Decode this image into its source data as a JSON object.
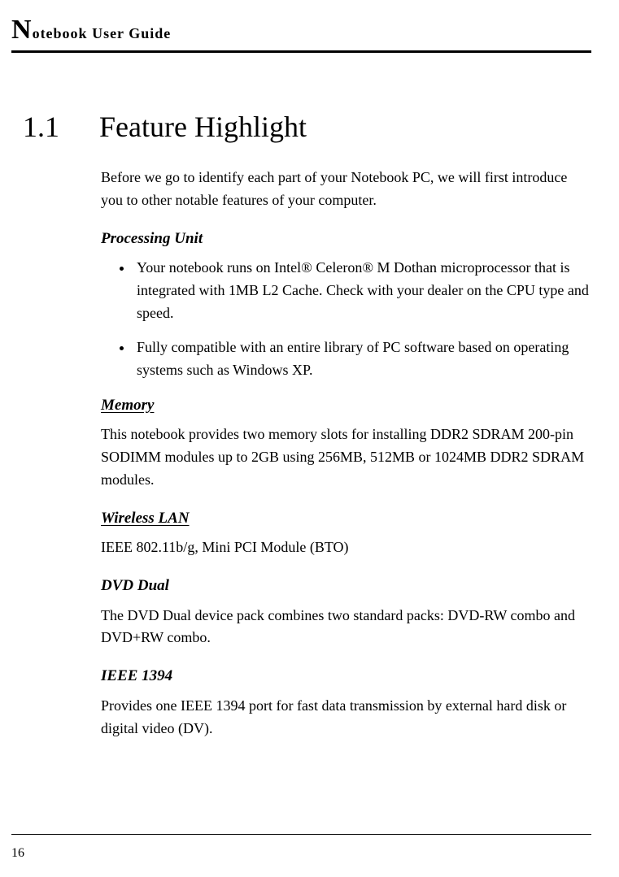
{
  "header": {
    "bigLetter": "N",
    "rest": "otebook User Guide"
  },
  "section": {
    "number": "1.1",
    "title": "Feature Highlight"
  },
  "intro": "Before we go to identify each part of your Notebook PC, we will first introduce you to other notable features of your computer.",
  "processing": {
    "heading": "Processing Unit",
    "bullets": [
      "Your notebook runs on Intel® Celeron® M Dothan microprocessor that is integrated with 1MB L2 Cache. Check with your dealer on the CPU type and speed.",
      "Fully compatible with an entire library of PC software based on operating systems such as Windows XP."
    ]
  },
  "memory": {
    "heading": "Memory",
    "text": "This notebook provides two memory slots for installing DDR2 SDRAM 200-pin SODIMM modules up to 2GB using 256MB, 512MB or 1024MB DDR2 SDRAM modules."
  },
  "wireless": {
    "heading": "Wireless LAN",
    "text": "IEEE 802.11b/g, Mini PCI Module (BTO)"
  },
  "dvd": {
    "heading": "DVD Dual",
    "text": "The DVD Dual device pack combines two standard packs: DVD-RW combo and DVD+RW combo."
  },
  "ieee1394": {
    "heading": "IEEE 1394",
    "text": "Provides one IEEE 1394 port for fast data transmission by external hard disk or digital video (DV)."
  },
  "pageNumber": "16"
}
